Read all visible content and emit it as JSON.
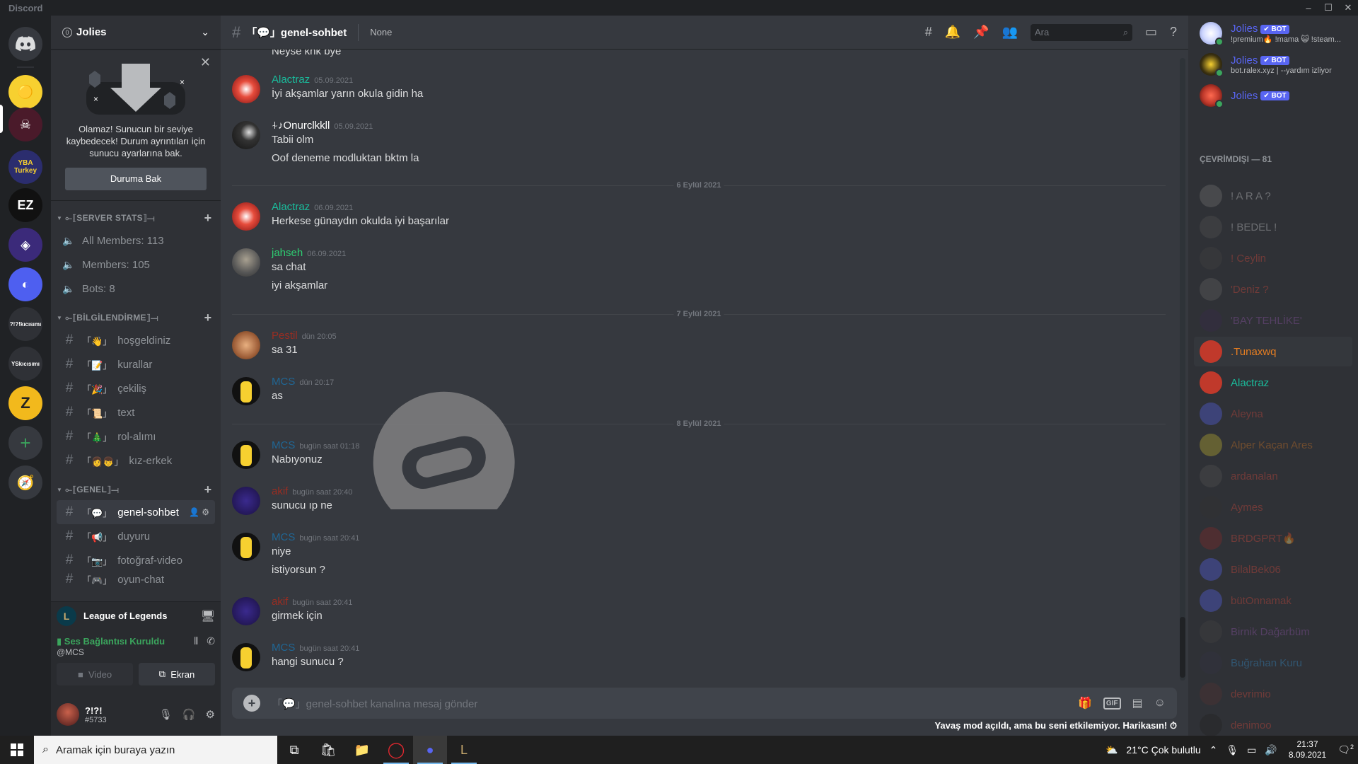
{
  "window": {
    "app_name": "Discord",
    "controls": [
      "–",
      "☐",
      "✕"
    ]
  },
  "servers": [
    {
      "label": "",
      "name": "home",
      "bg": "#36393f"
    },
    {
      "label": "",
      "name": "server-bart",
      "bg": "#f7d030"
    },
    {
      "label": "",
      "name": "server-jolies",
      "bg": "#4a1a2a"
    },
    {
      "label": "YBA Turkey",
      "name": "server-yba",
      "bg": "#2b2d6e"
    },
    {
      "label": "EZ",
      "name": "server-ez",
      "bg": "#111"
    },
    {
      "label": "",
      "name": "server-purple",
      "bg": "#3b2a7a"
    },
    {
      "label": "",
      "name": "server-blue",
      "bg": "#4e5ff0"
    },
    {
      "label": "?!?!kıcısımı",
      "name": "server-q",
      "bg": "#2f3136"
    },
    {
      "label": "YSkıcısımı",
      "name": "server-ys",
      "bg": "#2f3136"
    },
    {
      "label": "Z",
      "name": "server-z",
      "bg": "#f2b91c"
    }
  ],
  "guild": {
    "name": "Jolies",
    "boost": "0"
  },
  "notice": {
    "text": "Olamaz! Sunucun bir seviye kaybedecek! Durum ayrıntıları için sunucu ayarlarına bak.",
    "button": "Duruma Bak"
  },
  "categories": [
    {
      "label": "⟜⟦SERVER STATS⟧⟞",
      "channels": [
        {
          "type": "voice",
          "name": "All Members: 113"
        },
        {
          "type": "voice",
          "name": "Members: 105"
        },
        {
          "type": "voice",
          "name": "Bots: 8"
        }
      ]
    },
    {
      "label": "⟜⟦BİLGİLENDİRME⟧⟞",
      "channels": [
        {
          "type": "text",
          "emoji": "「👋」",
          "name": "hoşgeldiniz"
        },
        {
          "type": "text",
          "emoji": "「📝」",
          "name": "kurallar"
        },
        {
          "type": "text",
          "emoji": "「🎉」",
          "name": "çekiliş"
        },
        {
          "type": "text",
          "emoji": "「📜」",
          "name": "text"
        },
        {
          "type": "text",
          "emoji": "「🎄」",
          "name": "rol-alımı"
        },
        {
          "type": "text",
          "emoji": "「👩👦」",
          "name": "kız-erkek"
        }
      ]
    },
    {
      "label": "⟜⟦GENEL⟧⟞",
      "channels": [
        {
          "type": "text",
          "emoji": "「💬」",
          "name": "genel-sohbet",
          "active": true
        },
        {
          "type": "text",
          "emoji": "「📢」",
          "name": "duyuru"
        },
        {
          "type": "text",
          "emoji": "「📷」",
          "name": "fotoğraf-video"
        },
        {
          "type": "text",
          "emoji": "「🎮」",
          "name": "oyun-chat"
        }
      ]
    }
  ],
  "activity": {
    "game": "League of Legends"
  },
  "voice": {
    "status": "Ses Bağlantısı Kuruldu",
    "sub": "@MCS",
    "video": "Video",
    "screen": "Ekran"
  },
  "user": {
    "name": "?!?!",
    "tag": "#5733"
  },
  "header": {
    "channel": "「💬」genel-sohbet",
    "topic": "None",
    "search_placeholder": "Ara"
  },
  "messages": [
    {
      "author": "",
      "color": "#dcddde",
      "ts": "",
      "lines": [
        "Neyse knk bye"
      ],
      "y": 8,
      "avatar": ""
    },
    {
      "author": "Alactraz",
      "color": "#1abc9c",
      "ts": "05.09.2021",
      "lines": [
        "İyi akşamlar yarın okula gidin ha"
      ],
      "avatar": "#c0392b"
    },
    {
      "author": "⍭♪Onurclkkll",
      "color": "#ffffff",
      "ts": "05.09.2021",
      "lines": [
        "Tabii olm",
        "Oof deneme modluktan bktm la"
      ],
      "avatar": "#202020"
    },
    {
      "author": "Alactraz",
      "color": "#1abc9c",
      "ts": "06.09.2021",
      "lines": [
        "Herkese günaydın okulda iyi başarılar"
      ],
      "avatar": "#c0392b"
    },
    {
      "author": "jahseh",
      "color": "#2ecc71",
      "ts": "06.09.2021",
      "lines": [
        "sa chat",
        "iyi akşamlar"
      ],
      "avatar": "#6d6d6d"
    },
    {
      "author": "Pestil",
      "color": "#992d22",
      "ts": "dün 20:05",
      "lines": [
        "sa 31"
      ],
      "avatar": "#c07a4a"
    },
    {
      "author": "MCS",
      "color": "#206694",
      "ts": "dün 20:17",
      "lines": [
        "as"
      ],
      "avatar": "#f7d030"
    },
    {
      "author": "MCS",
      "color": "#206694",
      "ts": "bugün saat 01:18",
      "lines": [
        "Nabıyonuz"
      ],
      "avatar": "#f7d030"
    },
    {
      "author": "akif",
      "color": "#992d22",
      "ts": "bugün saat 20:40",
      "lines": [
        "sunucu ıp ne"
      ],
      "avatar": "#2a1a5e"
    },
    {
      "author": "MCS",
      "color": "#206694",
      "ts": "bugün saat 20:41",
      "lines": [
        "niye",
        "istiyorsun ?"
      ],
      "avatar": "#f7d030"
    },
    {
      "author": "akif",
      "color": "#992d22",
      "ts": "bugün saat 20:41",
      "lines": [
        "girmek için"
      ],
      "avatar": "#2a1a5e"
    },
    {
      "author": "MCS",
      "color": "#206694",
      "ts": "bugün saat 20:41",
      "lines": [
        "hangi sunucu ?"
      ],
      "avatar": "#f7d030"
    }
  ],
  "date_separators": [
    "6 Eylül 2021",
    "7 Eylül 2021",
    "8 Eylül 2021"
  ],
  "composer": {
    "placeholder": "「💬」genel-sohbet kanalına mesaj gönder"
  },
  "slowmode": "Yavaş mod açıldı, ama bu seni etkilemiyor. Harikasın!",
  "members": {
    "online": [
      {
        "name": "Jolies",
        "bot": "✔ BOT",
        "activity": "!premium🔥 !mama 😺 !steam...",
        "avatar": "#e0e8ff"
      },
      {
        "name": "Jolies",
        "bot": "✔ BOT",
        "activity": "bot.ralex.xyz | --yardım izliyor",
        "avatar": "#2b2b10"
      },
      {
        "name": "Jolies",
        "bot": "✔ BOT",
        "activity": "",
        "avatar": "#c0392b"
      }
    ],
    "offline_header": "ÇEVRİMDIŞI — 81",
    "offline": [
      {
        "name": "! A R A ?",
        "color": "#dcddde",
        "avatar": "#777"
      },
      {
        "name": "! BEDEL ! ",
        "color": "#dcddde",
        "avatar": "#555"
      },
      {
        "name": "! Ceylin",
        "color": "#e74c3c",
        "avatar": "#444"
      },
      {
        "name": "'Deniz ?",
        "color": "#e74c3c",
        "avatar": "#666"
      },
      {
        "name": "'BAY TEHLİKE'",
        "color": "#9b59b6",
        "avatar": "#3a2a4a"
      },
      {
        "name": ".Tunaxwq",
        "color": "#e67e22",
        "avatar": "#c0392b",
        "hl": true
      },
      {
        "name": "Alactraz",
        "color": "#1abc9c",
        "avatar": "#c0392b",
        "hl_plain": true
      },
      {
        "name": "Aleyna",
        "color": "#e74c3c",
        "avatar": "#5865f2"
      },
      {
        "name": "Alper Kaçan Ares",
        "color": "#e67e22",
        "avatar": "#c8b830"
      },
      {
        "name": "ardanalan",
        "color": "#e74c3c",
        "avatar": "#555"
      },
      {
        "name": "Aymes",
        "color": "#e74c3c",
        "avatar": "#333"
      },
      {
        "name": "BRDGPRT🔥",
        "color": "#e74c3c",
        "avatar": "#8a2a2a"
      },
      {
        "name": "BilalBek06",
        "color": "#e74c3c",
        "avatar": "#5865f2"
      },
      {
        "name": "bütOnnamak",
        "color": "#e74c3c",
        "avatar": "#5865f2"
      },
      {
        "name": "Birnik Dağarbüm",
        "color": "#9b59b6",
        "avatar": "#444"
      },
      {
        "name": "Buğrahan Kuru",
        "color": "#3498db",
        "avatar": "#334"
      },
      {
        "name": "devrimio",
        "color": "#e74c3c",
        "avatar": "#533"
      },
      {
        "name": "denimoo",
        "color": "#e74c3c",
        "avatar": "#222"
      }
    ]
  },
  "taskbar": {
    "search_placeholder": "Aramak için buraya yazın",
    "weather": "21°C  Çok bulutlu",
    "time": "21:37",
    "date": "8.09.2021",
    "notif_count": "2"
  }
}
